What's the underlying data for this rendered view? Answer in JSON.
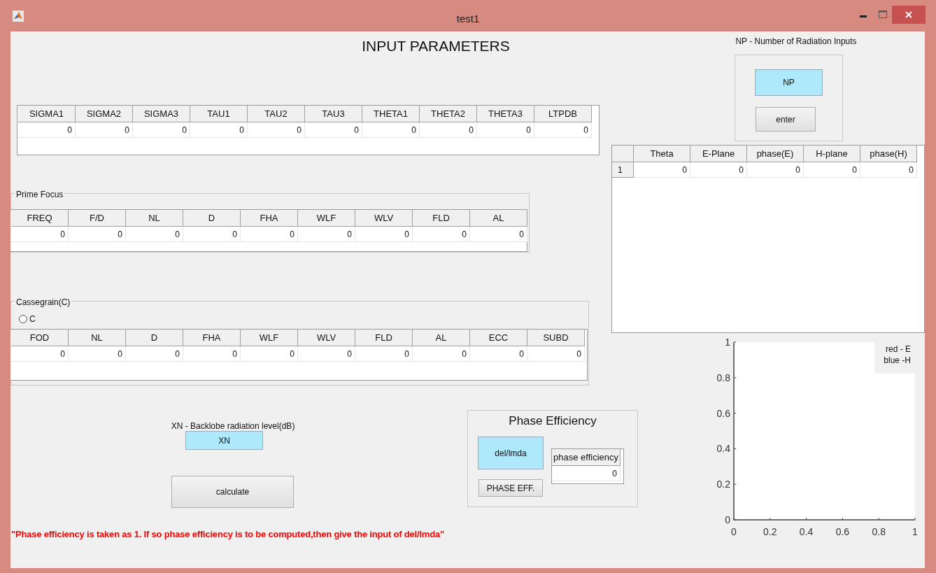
{
  "window": {
    "title": "test1"
  },
  "heading": "INPUT PARAMETERS",
  "main_table": {
    "columns": [
      "SIGMA1",
      "SIGMA2",
      "SIGMA3",
      "TAU1",
      "TAU2",
      "TAU3",
      "THETA1",
      "THETA2",
      "THETA3",
      "LTPDB"
    ],
    "rows": [
      [
        "0",
        "0",
        "0",
        "0",
        "0",
        "0",
        "0",
        "0",
        "0",
        "0"
      ]
    ]
  },
  "prime_focus": {
    "title": "Prime Focus",
    "columns": [
      "FREQ",
      "F/D",
      "NL",
      "D",
      "FHA",
      "WLF",
      "WLV",
      "FLD",
      "AL"
    ],
    "rows": [
      [
        "0",
        "0",
        "0",
        "0",
        "0",
        "0",
        "0",
        "0",
        "0"
      ]
    ]
  },
  "cassegrain": {
    "title": "Cassegrain(C)",
    "radio": {
      "label": "C",
      "selected": false
    },
    "columns": [
      "FOD",
      "NL",
      "D",
      "FHA",
      "WLF",
      "WLV",
      "FLD",
      "AL",
      "ECC",
      "SUBD"
    ],
    "rows": [
      [
        "0",
        "0",
        "0",
        "0",
        "0",
        "0",
        "0",
        "0",
        "0",
        "0"
      ]
    ]
  },
  "np_section": {
    "label": "NP - Number of Radiation Inputs",
    "field_value": "NP",
    "button": "enter"
  },
  "radiation_table": {
    "columns": [
      "Theta",
      "E-Plane",
      "phase(E)",
      "H-plane",
      "phase(H)"
    ],
    "rows": [
      {
        "row_header": "1",
        "cells": [
          "0",
          "0",
          "0",
          "0",
          "0"
        ]
      }
    ]
  },
  "plot": {
    "legend": [
      "red - E",
      "blue -H"
    ],
    "chart_data": {
      "type": "line",
      "xlim": [
        0,
        1
      ],
      "ylim": [
        0,
        1
      ],
      "xticks": [
        0,
        {
          "value": 0.2,
          "label": "0.2"
        },
        {
          "value": 0.4,
          "label": "0.4"
        },
        {
          "value": 0.6,
          "label": "0.6"
        },
        {
          "value": 0.8,
          "label": "0.8"
        },
        1
      ],
      "yticks": [
        0,
        {
          "value": 0.2,
          "label": "0.2"
        },
        {
          "value": 0.4,
          "label": "0.4"
        },
        {
          "value": 0.6,
          "label": "0.6"
        },
        {
          "value": 0.8,
          "label": "0.8"
        },
        1
      ]
    }
  },
  "xn_section": {
    "label": "XN - Backlobe radiation level(dB)",
    "field_value": "XN"
  },
  "calculate_button": "calculate",
  "phase_efficiency": {
    "title": "Phase Efficiency",
    "field_value": "del/lmda",
    "button": "PHASE EFF.",
    "table": {
      "columns": [
        "phase efficiency"
      ],
      "rows": [
        [
          "0"
        ]
      ]
    }
  },
  "note": "\"Phase efficiency is taken as 1. If so phase efficiency is to be computed,then give the input of del/lmda\""
}
